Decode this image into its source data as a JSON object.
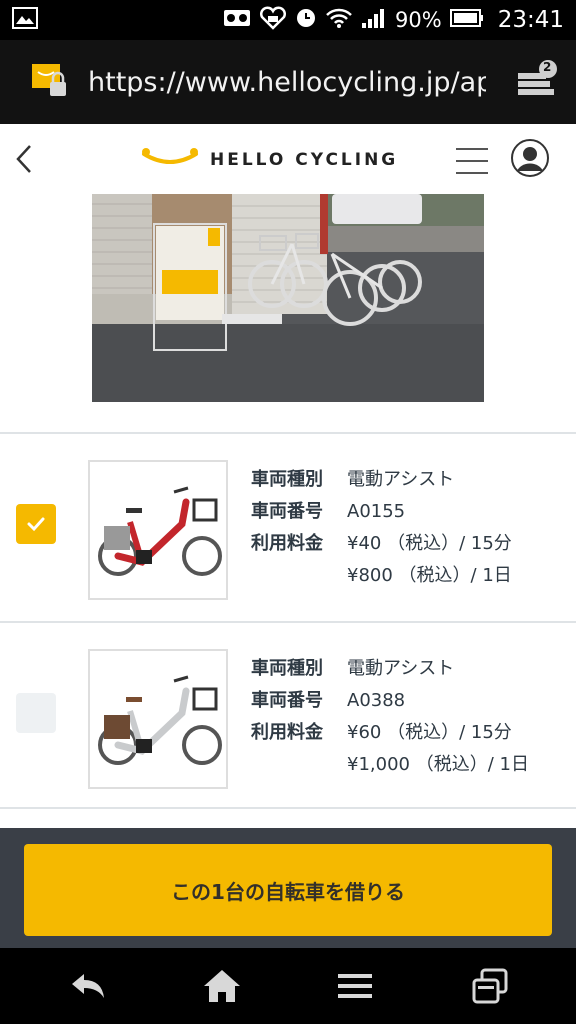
{
  "status_bar": {
    "battery_percent": "90%",
    "time": "23:41",
    "icons": [
      "image-icon",
      "voicemail-icon",
      "heart-badge-icon",
      "alarm-icon",
      "wifi-icon",
      "signal-icon",
      "battery-icon"
    ]
  },
  "browser": {
    "url": "https://www.hellocycling.jp/app",
    "tab_count": "2",
    "icons": [
      "site-lock-icon",
      "tabs-icon"
    ]
  },
  "header": {
    "logo_text": "HELLO CYCLING",
    "icons": [
      "back-arrow-icon",
      "logo-icon",
      "hamburger-menu-icon",
      "user-avatar-icon"
    ]
  },
  "bikes": [
    {
      "selected": true,
      "rows": [
        {
          "label": "車両種別",
          "value": "電動アシスト"
        },
        {
          "label": "車両番号",
          "value": "A0155"
        },
        {
          "label": "利用料金",
          "value": "¥40 （税込）/ 15分"
        }
      ],
      "extra_fee": "¥800 （税込）/ 1日",
      "frame_color": "#c3262c"
    },
    {
      "selected": false,
      "rows": [
        {
          "label": "車両種別",
          "value": "電動アシスト"
        },
        {
          "label": "車両番号",
          "value": "A0388"
        },
        {
          "label": "利用料金",
          "value": "¥60 （税込）/ 15分"
        }
      ],
      "extra_fee": "¥1,000 （税込）/ 1日",
      "frame_color": "#c9cbcd"
    }
  ],
  "rent_button": {
    "label": "この1台の自転車を借りる"
  },
  "colors": {
    "accent": "#f5b900",
    "footer": "#3a3f47"
  },
  "nav_icons": [
    "back-icon",
    "home-icon",
    "menu-icon",
    "recent-apps-icon"
  ]
}
